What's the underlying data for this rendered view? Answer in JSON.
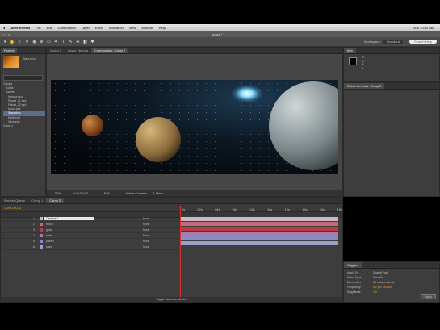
{
  "menubar": {
    "app": "After Effects",
    "items": [
      "File",
      "Edit",
      "Composition",
      "Layer",
      "Effect",
      "Animation",
      "View",
      "Window",
      "Help"
    ],
    "clock": "Sun 10:00 AM"
  },
  "window": {
    "title": "space *"
  },
  "toolbar": {
    "workspace_label": "Workspace:",
    "workspace_value": "Standard",
    "search_placeholder": "Search Help"
  },
  "project": {
    "tab": "Project",
    "selected_name": "Stars.mov",
    "items": [
      "Comps",
      "Solids",
      "Assets",
      "Nebula.psd",
      "Planet_01.psd",
      "Planet_02.psd",
      "Moon.psd",
      "Stars.mov",
      "Earth.psd",
      "Glow.psd",
      "Comp 1"
    ]
  },
  "comp_tabs": [
    "Comp 1",
    "Layer: Nebula",
    "Composition: Comp 2"
  ],
  "viewer": {
    "zoom": "50%",
    "timecode": "0;00;00;00",
    "resolution": "Full",
    "camera": "Active Camera",
    "views": "1 View"
  },
  "effects_panel": {
    "tab": "Effect Controls: Comp 2"
  },
  "info_panel": {
    "tab": "Info",
    "r": "R:",
    "g": "G:",
    "b": "B:",
    "a": "A:"
  },
  "timeline": {
    "tabs": [
      "Render Queue",
      "Comp 1",
      "Comp 2"
    ],
    "timecode": "0;00;00;00",
    "layers": [
      {
        "num": "1",
        "name": "Camera 1",
        "color": "#c9b9c8"
      },
      {
        "num": "2",
        "name": "moon",
        "color": "#c46a78"
      },
      {
        "num": "3",
        "name": "glow",
        "color": "#c03a44"
      },
      {
        "num": "4",
        "name": "earth",
        "color": "#a57ba8"
      },
      {
        "num": "5",
        "name": "planet",
        "color": "#8b8bc4"
      },
      {
        "num": "6",
        "name": "stars",
        "color": "#9aa0c8"
      }
    ],
    "parent_label": "None",
    "ruler": [
      "0s",
      "02s",
      "04s",
      "06s",
      "08s",
      "10s",
      "12s",
      "14s",
      "16s",
      "18s"
    ],
    "footer": "Toggle Switches / Modes"
  },
  "wiggler": {
    "tab": "Wiggler",
    "rows": [
      {
        "label": "Apply To:",
        "value": "Spatial Path"
      },
      {
        "label": "Noise Type:",
        "value": "Smooth"
      },
      {
        "label": "Dimension:",
        "value": "All Independently"
      },
      {
        "label": "Frequency:",
        "value": "5.0 per second"
      },
      {
        "label": "Magnitude:",
        "value": "1.0"
      }
    ],
    "apply": "Apply"
  }
}
